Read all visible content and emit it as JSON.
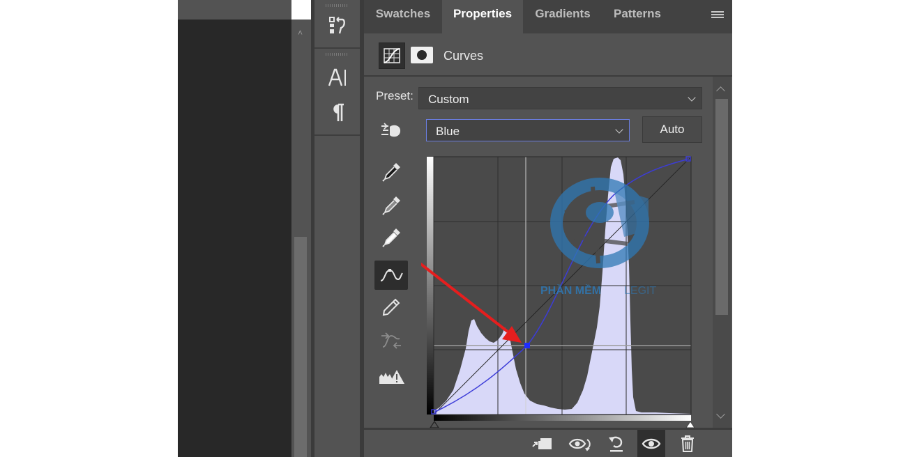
{
  "tabs": [
    "Swatches",
    "Properties",
    "Gradients",
    "Patterns"
  ],
  "active_tab": "Properties",
  "panel": {
    "title": "Curves",
    "preset_label": "Preset:",
    "preset_value": "Custom",
    "channel_value": "Blue",
    "auto_label": "Auto"
  },
  "watermark": {
    "text_bold": "PHẦN MỀM",
    "text_light": "LEGIT"
  },
  "colors": {
    "panel_bg": "#535353",
    "tab_bar_bg": "#424242",
    "graph_bg": "#4a4a4a",
    "histogram_fill": "#d8d8f8",
    "curve": "#3c3cd8",
    "annotation_arrow": "#e61e1e"
  },
  "tool_strip_icons": [
    "history-icon",
    "character-icon",
    "paragraph-icon"
  ],
  "curve_tools": [
    "target-adjustment-icon",
    "black-eyedropper-icon",
    "gray-eyedropper-icon",
    "white-eyedropper-icon",
    "curve-point-icon",
    "pencil-icon",
    "smooth-icon",
    "clipping-warning-icon"
  ],
  "bottom_icons": [
    "clip-to-layer-icon",
    "view-previous-icon",
    "reset-icon",
    "visibility-icon",
    "delete-icon"
  ]
}
